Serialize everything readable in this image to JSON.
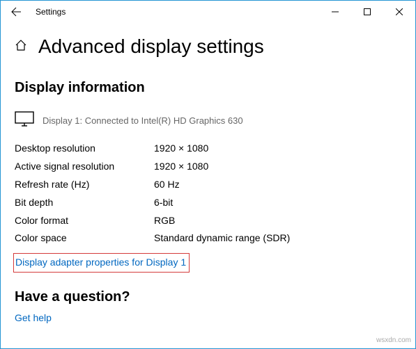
{
  "titlebar": {
    "label": "Settings"
  },
  "header": {
    "title": "Advanced display settings"
  },
  "display_info": {
    "heading": "Display information",
    "connected": "Display 1: Connected to Intel(R) HD Graphics 630",
    "rows": [
      {
        "key": "Desktop resolution",
        "val": "1920 × 1080"
      },
      {
        "key": "Active signal resolution",
        "val": "1920 × 1080"
      },
      {
        "key": "Refresh rate (Hz)",
        "val": "60 Hz"
      },
      {
        "key": "Bit depth",
        "val": "6-bit"
      },
      {
        "key": "Color format",
        "val": "RGB"
      },
      {
        "key": "Color space",
        "val": "Standard dynamic range (SDR)"
      }
    ],
    "adapter_link": "Display adapter properties for Display 1"
  },
  "question": {
    "heading": "Have a question?",
    "help_link": "Get help"
  },
  "watermark": "wsxdn.com"
}
